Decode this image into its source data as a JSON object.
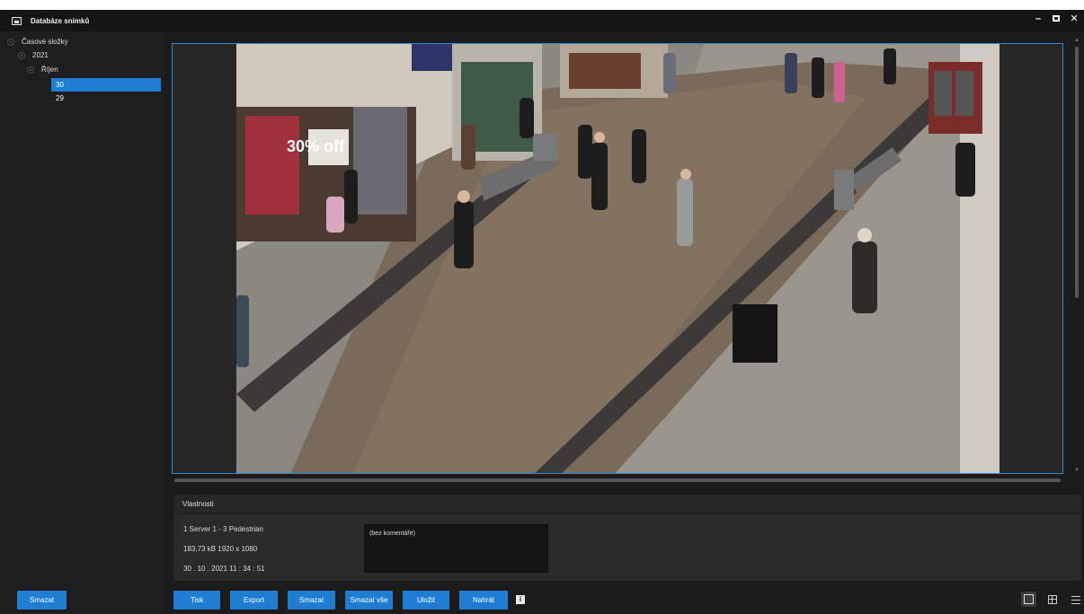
{
  "window": {
    "title": "Databáze snímků",
    "controls": {
      "minimize": "–",
      "close": "✕"
    }
  },
  "tree": {
    "root": "Časové složky",
    "year": "2021",
    "month": "Říjen",
    "days": [
      "30",
      "29"
    ],
    "selected_day": "30"
  },
  "viewer": {
    "image_alt": "Pedestrian street camera snapshot",
    "storefront_sign": "30% off"
  },
  "properties": {
    "header": "Vlastnosti",
    "camera": "1 Server 1 - 3 Pedestrian",
    "size_info": "183,73 kB   1920 x 1080",
    "timestamp": "30 . 10 . 2021 11 : 34 : 51",
    "comment": "(bez komentáře)"
  },
  "buttons": {
    "left_delete": "Smazat",
    "print": "Tisk",
    "export": "Export",
    "delete": "Smazat",
    "delete_all": "Smazat vše",
    "save": "Uložit",
    "upload": "Nahrát",
    "info": "i"
  },
  "colors": {
    "accent": "#1f7ed3",
    "background": "#1b1b1b",
    "frame_border": "#2a8ad6"
  }
}
